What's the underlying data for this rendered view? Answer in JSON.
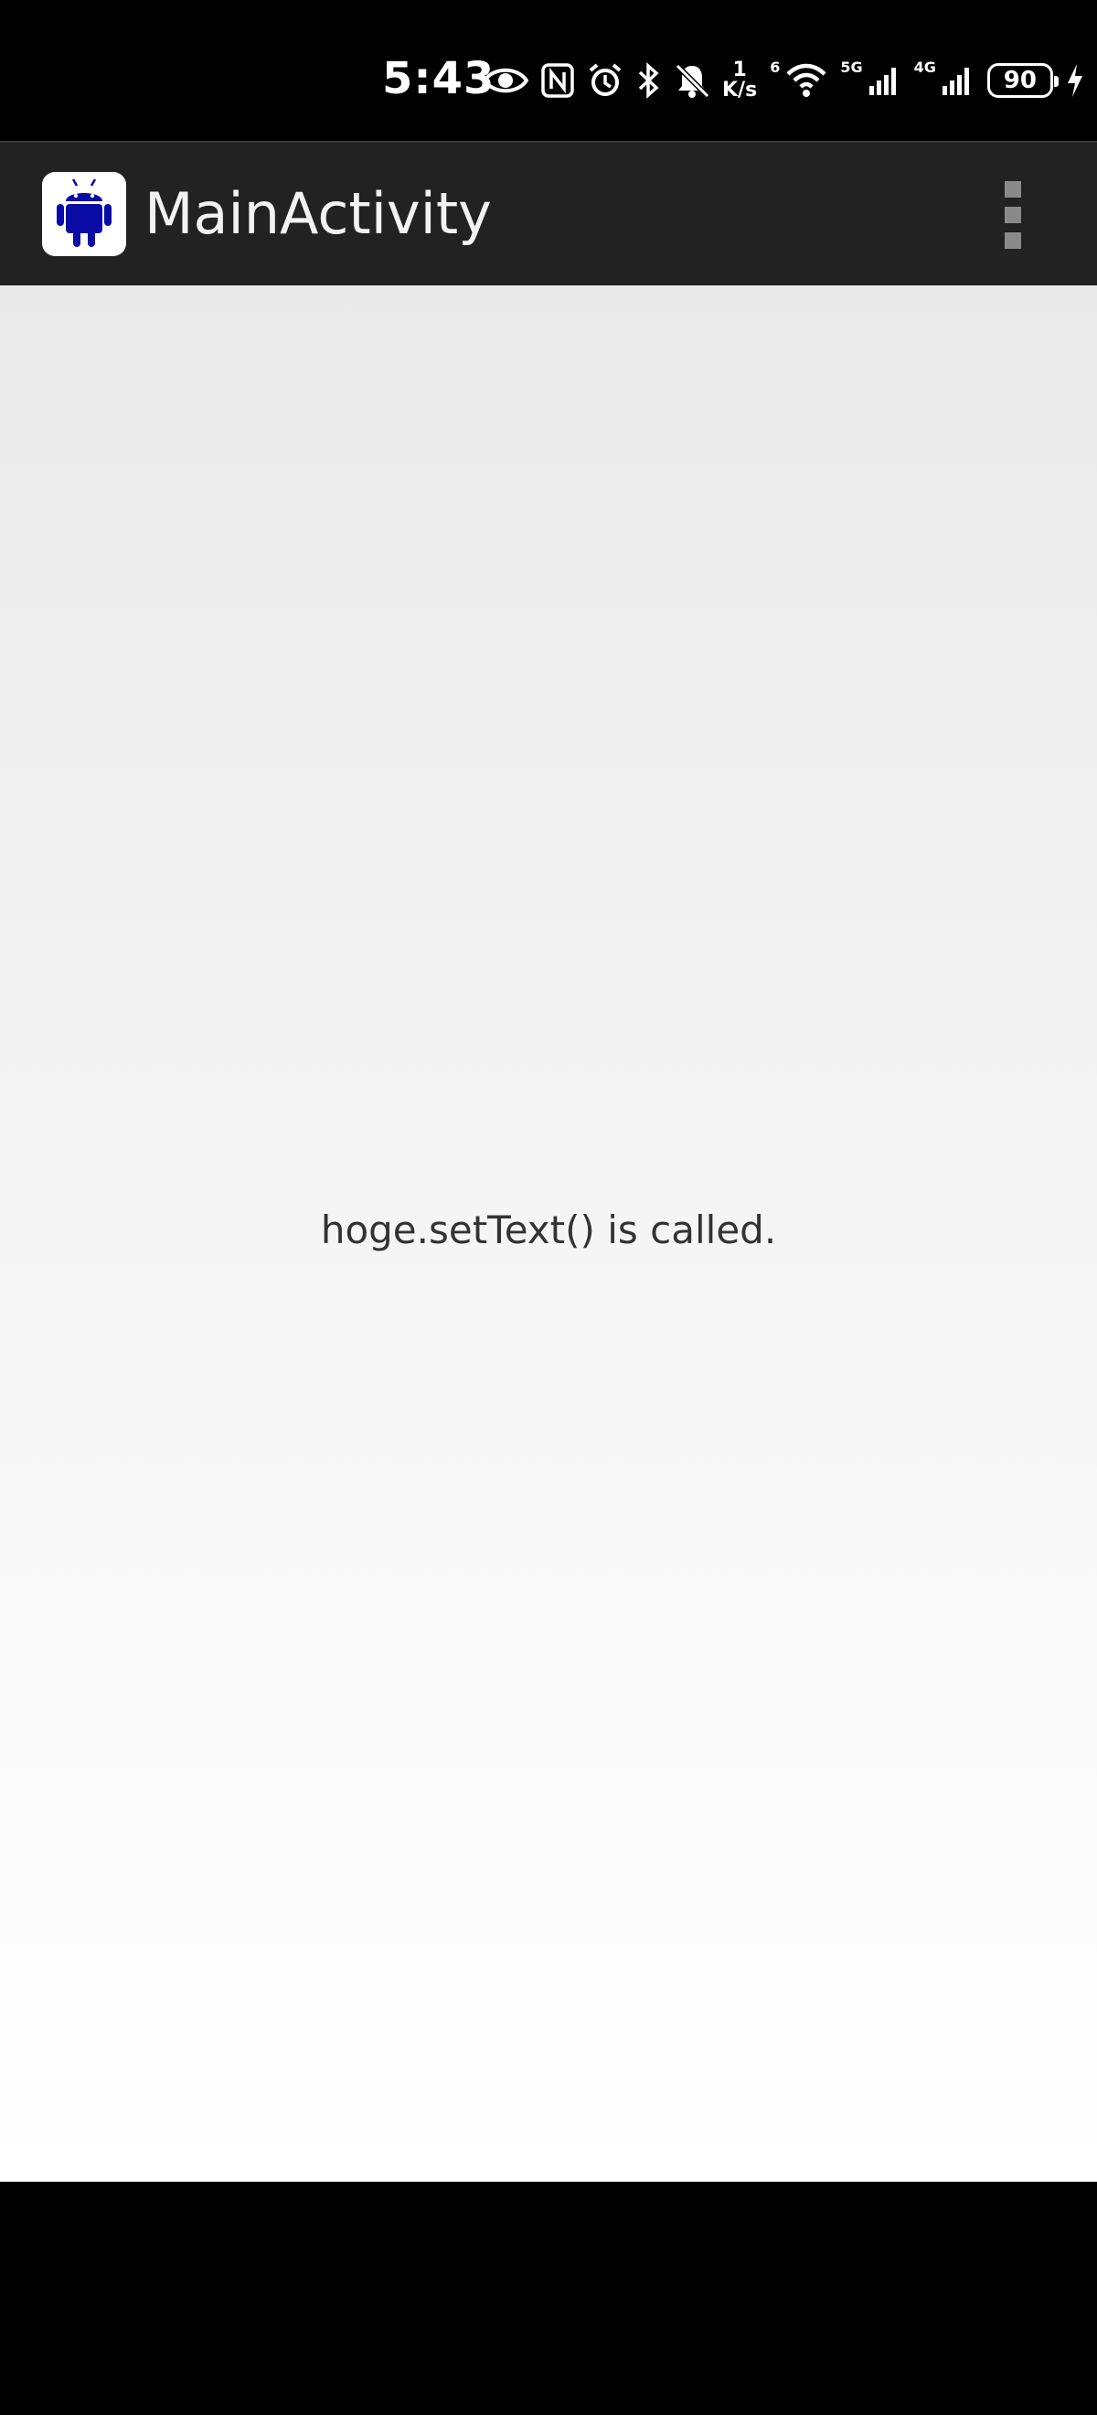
{
  "status_bar": {
    "time": "5:43",
    "speed_value": "1",
    "speed_unit": "K/s",
    "wifi_label": "6",
    "net1_label": "5G",
    "net2_label": "4G",
    "battery_level": "90",
    "icons": [
      "eye-icon",
      "nfc-icon",
      "alarm-icon",
      "bluetooth-icon",
      "mute-bell-icon",
      "wifi-icon",
      "signal-icon",
      "signal-icon",
      "battery-icon",
      "charging-icon"
    ]
  },
  "action_bar": {
    "title": "MainActivity",
    "app_icon": "android-robot-icon",
    "overflow_icon": "overflow-menu-icon"
  },
  "content": {
    "message": "hoge.setText() is called."
  },
  "colors": {
    "action_bar_bg": "#222222",
    "android_icon": "#0b0ba6",
    "text": "#333333"
  }
}
